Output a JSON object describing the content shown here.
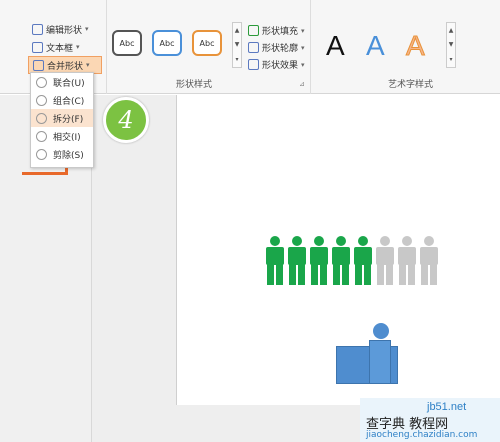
{
  "ribbon": {
    "left_commands": [
      {
        "label": "编辑形状",
        "icon": "edit-shape-icon"
      },
      {
        "label": "文本框",
        "icon": "text-box-icon"
      },
      {
        "label": "合并形状",
        "icon": "merge-shapes-icon"
      }
    ],
    "shape_styles": {
      "swatches": [
        "Abc",
        "Abc",
        "Abc"
      ],
      "swatch_colors": [
        "#555555",
        "#4a90d9",
        "#e8933a"
      ],
      "group_label": "形状样式"
    },
    "fill_commands": [
      {
        "label": "形状填充",
        "icon": "shape-fill-icon"
      },
      {
        "label": "形状轮廓",
        "icon": "shape-outline-icon"
      },
      {
        "label": "形状效果",
        "icon": "shape-effects-icon"
      }
    ],
    "wordart": {
      "samples": [
        "A",
        "A",
        "A"
      ],
      "colors": [
        "#111111",
        "#4a90d9",
        "#e8933a"
      ],
      "group_label": "艺术字样式"
    }
  },
  "merge_menu": {
    "items": [
      {
        "label": "联合(U)",
        "highlighted": false
      },
      {
        "label": "组合(C)",
        "highlighted": false
      },
      {
        "label": "拆分(F)",
        "highlighted": true
      },
      {
        "label": "相交(I)",
        "highlighted": false
      },
      {
        "label": "剪除(S)",
        "highlighted": false
      }
    ]
  },
  "step_badge": "4",
  "people_chart": {
    "total": 8,
    "highlighted": 5,
    "highlight_color": "#1aa64a",
    "muted_color": "#c8c8c8"
  },
  "watermark": {
    "line1": "jb51.net",
    "line2": "查字典 教程网",
    "line3": "jiaocheng.chazidian.com"
  }
}
